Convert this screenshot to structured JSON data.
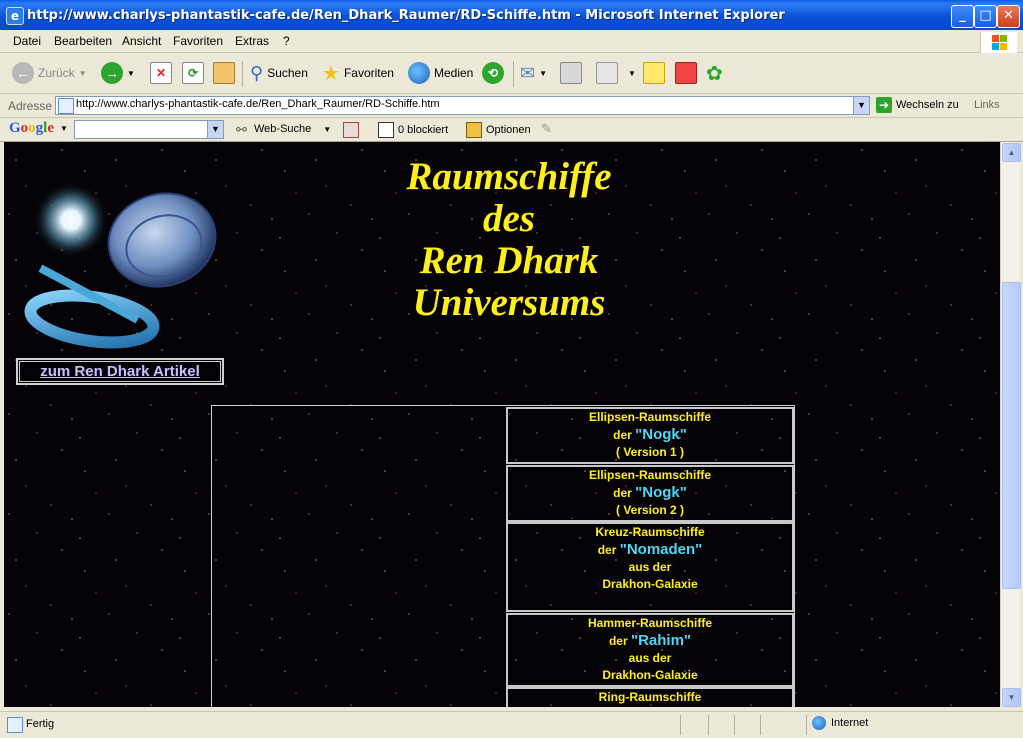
{
  "window": {
    "title": "http://www.charlys-phantastik-cafe.de/Ren_Dhark_Raumer/RD-Schiffe.htm - Microsoft Internet Explorer",
    "minimize": "_",
    "maximize": "□",
    "close": "✕"
  },
  "menu": [
    "Datei",
    "Bearbeiten",
    "Ansicht",
    "Favoriten",
    "Extras",
    "?"
  ],
  "toolbar": {
    "back": "Zurück",
    "search": "Suchen",
    "favorites": "Favoriten",
    "media": "Medien"
  },
  "address": {
    "label": "Adresse",
    "url": "http://www.charlys-phantastik-cafe.de/Ren_Dhark_Raumer/RD-Schiffe.htm",
    "go": "Wechseln zu",
    "links": "Links"
  },
  "google": {
    "logo": "Google",
    "web_search": "Web-Suche",
    "blocked": "0 blockiert",
    "options": "Optionen"
  },
  "page": {
    "headline": [
      "Raumschiffe",
      "des",
      "Ren Dhark",
      "Universums"
    ],
    "article_link": "zum Ren Dhark Artikel",
    "ships": [
      {
        "l1": "Ellipsen-Raumschiffe",
        "pre": "der",
        "race": "\"Nogk\"",
        "l3": "( Version 1 )",
        "l4": ""
      },
      {
        "l1": "Ellipsen-Raumschiffe",
        "pre": "der",
        "race": "\"Nogk\"",
        "l3": "( Version 2 )",
        "l4": ""
      },
      {
        "l1": "Kreuz-Raumschiffe",
        "pre": "der",
        "race": "\"Nomaden\"",
        "l3": "aus der",
        "l4": "Drakhon-Galaxie"
      },
      {
        "l1": "Hammer-Raumschiffe",
        "pre": "der",
        "race": "\"Rahim\"",
        "l3": "aus der",
        "l4": "Drakhon-Galaxie"
      },
      {
        "l1": "Ring-Raumschiffe",
        "pre": "",
        "race": "",
        "l3": "",
        "l4": ""
      }
    ]
  },
  "status": {
    "text": "Fertig",
    "zone": "Internet"
  }
}
